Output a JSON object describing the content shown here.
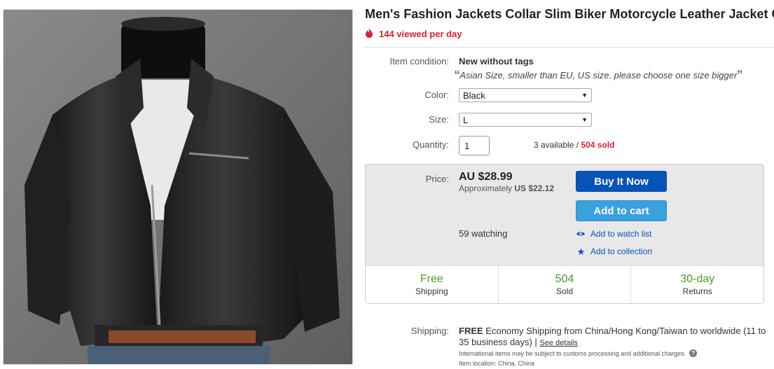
{
  "product": {
    "title": "Men's Fashion Jackets Collar Slim Biker Motorcycle Leather Jacket Coat",
    "viewed": "144 viewed per day"
  },
  "condition": {
    "label": "Item condition:",
    "value": "New without tags",
    "note_open": "“",
    "note": "Asian Size, smaller than EU, US size. please choose one size bigger",
    "note_close": "”"
  },
  "color": {
    "label": "Color:",
    "selected": "Black"
  },
  "size": {
    "label": "Size:",
    "selected": "L"
  },
  "quantity": {
    "label": "Quantity:",
    "value": "1",
    "available": "3 available",
    "separator": " / ",
    "sold": "504 sold"
  },
  "price": {
    "label": "Price:",
    "value": "AU $28.99",
    "approx_prefix": "Approximately",
    "approx_value": "US $22.12"
  },
  "buttons": {
    "buy_now": "Buy It Now",
    "add_to_cart": "Add to cart"
  },
  "watching": "59 watching",
  "links": {
    "watch_list": "Add to watch list",
    "collection": "Add to collection"
  },
  "highlights": [
    {
      "big": "Free",
      "small": "Shipping"
    },
    {
      "big": "504",
      "small": "Sold"
    },
    {
      "big": "30-day",
      "small": "Returns"
    }
  ],
  "shipping": {
    "label": "Shipping:",
    "free": "FREE",
    "text": "Economy Shipping from China/Hong Kong/Taiwan to worldwide (11 to 35 business days) |",
    "see_details": "See details",
    "intl_note": "International items may be subject to customs processing and additional charges.",
    "location": "Item location:  China, China"
  },
  "icons": {
    "flame": "flame-icon",
    "eye": "eye-icon",
    "star": "star-icon",
    "help": "help-icon"
  },
  "colors": {
    "accent_red": "#dd1e31",
    "buy_blue": "#0654ba",
    "cart_blue": "#3ba0e0",
    "green": "#4c9c1e"
  }
}
